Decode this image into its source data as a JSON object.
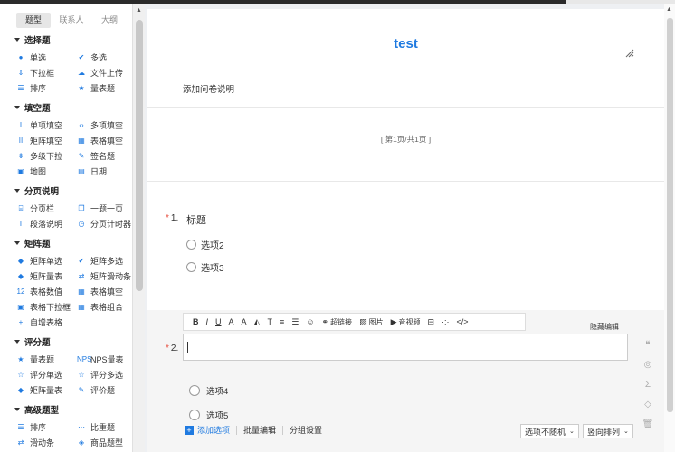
{
  "sidebar": {
    "tabs": [
      {
        "label": "题型",
        "active": true
      },
      {
        "label": "联系人",
        "active": false
      },
      {
        "label": "大纲",
        "active": false
      }
    ],
    "groups": [
      {
        "title": "选择题",
        "items": [
          {
            "icon": "●",
            "label": "单选",
            "icon_name": "radio-dot-icon"
          },
          {
            "icon": "✔",
            "label": "多选",
            "icon_name": "checkmark-icon"
          },
          {
            "icon": "⇕",
            "label": "下拉框",
            "icon_name": "dropdown-icon"
          },
          {
            "icon": "☁",
            "label": "文件上传",
            "icon_name": "cloud-upload-icon"
          },
          {
            "icon": "☰",
            "label": "排序",
            "icon_name": "list-icon"
          },
          {
            "icon": "★",
            "label": "量表题",
            "icon_name": "star-icon"
          }
        ]
      },
      {
        "title": "填空题",
        "items": [
          {
            "icon": "I",
            "label": "单项填空",
            "icon_name": "text-cursor-icon"
          },
          {
            "icon": "‹›",
            "label": "多项填空",
            "icon_name": "code-brackets-icon"
          },
          {
            "icon": "II",
            "label": "矩阵填空",
            "icon_name": "double-cursor-icon"
          },
          {
            "icon": "▦",
            "label": "表格填空",
            "icon_name": "table-icon"
          },
          {
            "icon": "⇟",
            "label": "多级下拉",
            "icon_name": "cascade-icon"
          },
          {
            "icon": "✎",
            "label": "签名题",
            "icon_name": "signature-icon"
          },
          {
            "icon": "▣",
            "label": "地图",
            "icon_name": "map-icon"
          },
          {
            "icon": "▤",
            "label": "日期",
            "icon_name": "calendar-icon"
          }
        ]
      },
      {
        "title": "分页说明",
        "items": [
          {
            "icon": "⌸",
            "label": "分页栏",
            "icon_name": "page-break-icon"
          },
          {
            "icon": "❐",
            "label": "一题一页",
            "icon_name": "copy-page-icon"
          },
          {
            "icon": "T",
            "label": "段落说明",
            "icon_name": "paragraph-icon"
          },
          {
            "icon": "◷",
            "label": "分页计时器",
            "icon_name": "timer-icon"
          }
        ]
      },
      {
        "title": "矩阵题",
        "items": [
          {
            "icon": "◆",
            "label": "矩阵单选",
            "icon_name": "matrix-radio-icon"
          },
          {
            "icon": "✔",
            "label": "矩阵多选",
            "icon_name": "matrix-check-icon"
          },
          {
            "icon": "◆",
            "label": "矩阵量表",
            "icon_name": "matrix-scale-icon"
          },
          {
            "icon": "⇄",
            "label": "矩阵滑动条",
            "icon_name": "slider-icon"
          },
          {
            "icon": "12",
            "label": "表格数值",
            "icon_name": "number-icon"
          },
          {
            "icon": "▦",
            "label": "表格填空",
            "icon_name": "table-fill-icon"
          },
          {
            "icon": "▣",
            "label": "表格下拉框",
            "icon_name": "table-dropdown-icon"
          },
          {
            "icon": "▦",
            "label": "表格组合",
            "icon_name": "table-combo-icon"
          },
          {
            "icon": "+",
            "label": "自增表格",
            "icon_name": "plus-icon"
          }
        ]
      },
      {
        "title": "评分题",
        "items": [
          {
            "icon": "★",
            "label": "量表题",
            "icon_name": "star-scale-icon"
          },
          {
            "icon": "NPS",
            "label": "NPS量表",
            "icon_name": "nps-icon"
          },
          {
            "icon": "☆",
            "label": "评分单选",
            "icon_name": "star-outline-icon"
          },
          {
            "icon": "☆",
            "label": "评分多选",
            "icon_name": "star-multi-icon"
          },
          {
            "icon": "◆",
            "label": "矩阵量表",
            "icon_name": "matrix-scale-icon"
          },
          {
            "icon": "✎",
            "label": "评价题",
            "icon_name": "pen-icon"
          }
        ]
      },
      {
        "title": "高级题型",
        "items": [
          {
            "icon": "☰",
            "label": "排序",
            "icon_name": "sort-icon"
          },
          {
            "icon": "⋯",
            "label": "比重题",
            "icon_name": "weight-icon"
          },
          {
            "icon": "⇄",
            "label": "滑动条",
            "icon_name": "slider-icon"
          },
          {
            "icon": "◈",
            "label": "商品题型",
            "icon_name": "product-icon"
          }
        ]
      }
    ]
  },
  "survey": {
    "title": "test",
    "description": "添加问卷说明",
    "page_info": "[ 第1页/共1页 ]"
  },
  "question1": {
    "required_mark": "*",
    "number": "1.",
    "title": "标题",
    "options": [
      "选项2",
      "选项3"
    ]
  },
  "editor": {
    "toolbar": [
      {
        "icon": "B",
        "name": "bold-icon",
        "label": ""
      },
      {
        "icon": "I",
        "name": "italic-icon",
        "label": ""
      },
      {
        "icon": "U",
        "name": "underline-icon",
        "label": ""
      },
      {
        "icon": "A",
        "name": "font-size-icon",
        "label": ""
      },
      {
        "icon": "A",
        "name": "font-color-icon",
        "label": ""
      },
      {
        "icon": "◭",
        "name": "fill-color-icon",
        "label": ""
      },
      {
        "icon": "T",
        "name": "clear-format-icon",
        "label": ""
      },
      {
        "icon": "≡",
        "name": "align-icon",
        "label": ""
      },
      {
        "icon": "☰",
        "name": "list-format-icon",
        "label": ""
      },
      {
        "icon": "☺",
        "name": "emoji-icon",
        "label": ""
      },
      {
        "icon": "⚭",
        "name": "link-icon",
        "label": "超链接"
      },
      {
        "icon": "▨",
        "name": "image-icon",
        "label": "图片"
      },
      {
        "icon": "▶",
        "name": "video-icon",
        "label": "音视频"
      },
      {
        "icon": "⊟",
        "name": "blank-icon",
        "label": ""
      },
      {
        "icon": "·:·",
        "name": "more-icon",
        "label": ""
      },
      {
        "icon": "</>",
        "name": "source-code-icon",
        "label": ""
      }
    ],
    "hide_edit_label": "隐藏编辑",
    "question2_required": "*",
    "question2_number": "2.",
    "question2_value": "",
    "options": [
      "选项4",
      "选项5"
    ],
    "add_option": "添加选项",
    "batch_edit": "批量编辑",
    "group_settings": "分组设置",
    "random_select": "选项不随机",
    "layout_select": "竖向排列"
  },
  "side_tools": [
    {
      "icon": "❝",
      "name": "quote-icon"
    },
    {
      "icon": "◎",
      "name": "hide-eye-icon"
    },
    {
      "icon": "Σ",
      "name": "sum-icon"
    },
    {
      "icon": "◇",
      "name": "tag-icon"
    },
    {
      "icon": "🗑",
      "name": "trash-icon"
    }
  ],
  "colors": {
    "accent": "#1f7ae0",
    "required": "#e74c3c"
  }
}
